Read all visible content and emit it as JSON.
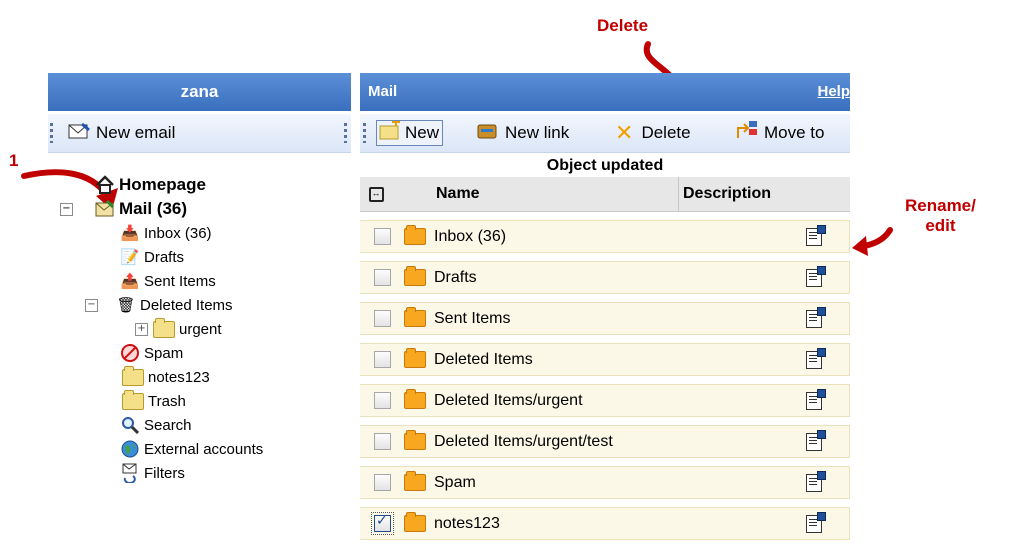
{
  "annotations": {
    "delete": "Delete",
    "one": "1",
    "rename": "Rename/\nedit"
  },
  "left": {
    "header": "zana",
    "new_email": "New email",
    "tree": {
      "homepage": "Homepage",
      "mail": "Mail (36)",
      "inbox": "Inbox (36)",
      "drafts": "Drafts",
      "sent": "Sent Items",
      "deleted": "Deleted Items",
      "urgent": "urgent",
      "spam": "Spam",
      "notes": "notes123",
      "trash": "Trash",
      "search": "Search",
      "external": "External accounts",
      "filters": "Filters"
    }
  },
  "right": {
    "header": "Mail",
    "help": "Help",
    "toolbar": {
      "new": "New",
      "new_link": "New link",
      "delete": "Delete",
      "move_to": "Move to"
    },
    "status": "Object updated",
    "columns": {
      "name": "Name",
      "description": "Description"
    },
    "rows": [
      {
        "name": "Inbox (36)",
        "checked": false
      },
      {
        "name": "Drafts",
        "checked": false
      },
      {
        "name": "Sent Items",
        "checked": false
      },
      {
        "name": "Deleted Items",
        "checked": false
      },
      {
        "name": "Deleted Items/urgent",
        "checked": false
      },
      {
        "name": "Deleted Items/urgent/test",
        "checked": false
      },
      {
        "name": "Spam",
        "checked": false
      },
      {
        "name": "notes123",
        "checked": true
      }
    ]
  },
  "colors": {
    "header_blue": "#3a6fbf",
    "annotation_red": "#c00000",
    "row_bg": "#fbf8e8",
    "folder_orange": "#f7a81f"
  }
}
